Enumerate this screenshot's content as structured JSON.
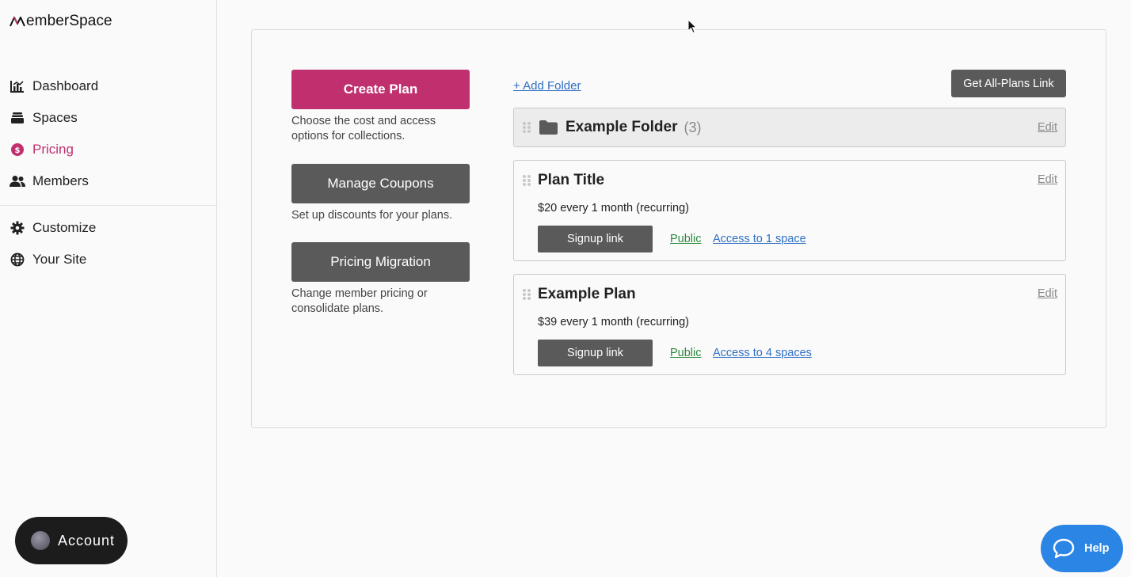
{
  "app": {
    "logo_text": "emberSpace"
  },
  "sidebar": {
    "items": [
      {
        "label": "Dashboard",
        "icon": "chart-icon"
      },
      {
        "label": "Spaces",
        "icon": "stack-icon"
      },
      {
        "label": "Pricing",
        "icon": "dollar-circle-icon",
        "active": true
      },
      {
        "label": "Members",
        "icon": "users-icon"
      }
    ],
    "items2": [
      {
        "label": "Customize",
        "icon": "gear-icon"
      },
      {
        "label": "Your Site",
        "icon": "globe-icon"
      }
    ],
    "account_label": "Account"
  },
  "actions": {
    "create_plan": {
      "label": "Create Plan",
      "desc": "Choose the cost and access options for collections."
    },
    "manage_coupons": {
      "label": "Manage Coupons",
      "desc": "Set up discounts for your plans."
    },
    "pricing_migration": {
      "label": "Pricing Migration",
      "desc": "Change member pricing or consolidate plans."
    }
  },
  "plans_area": {
    "add_folder": "+ Add Folder",
    "all_plans_link": "Get All-Plans Link",
    "folder": {
      "name": "Example Folder",
      "count": "(3)",
      "edit": "Edit"
    },
    "plans": [
      {
        "title": "Plan Title",
        "price": "$20 every 1 month (recurring)",
        "signup": "Signup link",
        "visibility": "Public",
        "access": "Access to 1 space",
        "edit": "Edit"
      },
      {
        "title": "Example Plan",
        "price": "$39 every 1 month (recurring)",
        "signup": "Signup link",
        "visibility": "Public",
        "access": "Access to 4 spaces",
        "edit": "Edit"
      }
    ]
  },
  "help": {
    "label": "Help"
  },
  "colors": {
    "accent": "#c0306f",
    "button_gray": "#5a5a5a",
    "link_blue": "#2f6fc4",
    "link_green": "#2b8a3e",
    "help_blue": "#2b85e4"
  }
}
